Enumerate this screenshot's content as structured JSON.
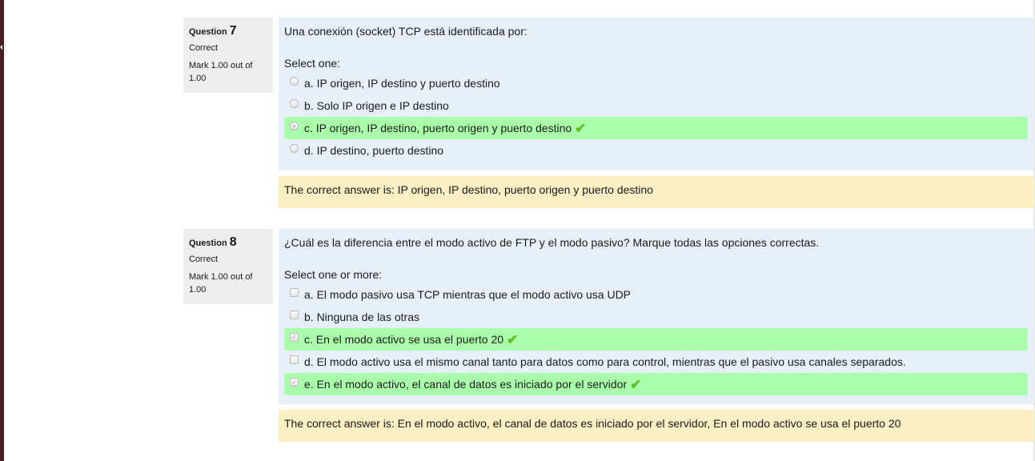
{
  "questions": [
    {
      "label": "Question",
      "number": "7",
      "state": "Correct",
      "grade": "Mark 1.00 out of 1.00",
      "text": "Una conexión (socket) TCP está identificada por:",
      "prompt": "Select one:",
      "input_type": "radio",
      "answers": [
        {
          "label": "a. IP origen, IP destino y puerto destino",
          "selected": false,
          "correct": false
        },
        {
          "label": "b. Solo IP origen e IP destino",
          "selected": false,
          "correct": false
        },
        {
          "label": "c. IP origen, IP destino, puerto origen y puerto destino",
          "selected": true,
          "correct": true
        },
        {
          "label": "d. IP destino, puerto destino",
          "selected": false,
          "correct": false
        }
      ],
      "feedback": "The correct answer is: IP origen, IP destino, puerto origen y puerto destino"
    },
    {
      "label": "Question",
      "number": "8",
      "state": "Correct",
      "grade": "Mark 1.00 out of 1.00",
      "text": "¿Cuál es la diferencia entre el modo activo de FTP y el modo pasivo? Marque todas las opciones correctas.",
      "prompt": "Select one or more:",
      "input_type": "checkbox",
      "answers": [
        {
          "label": "a. El modo pasivo usa TCP mientras que el modo activo usa UDP",
          "selected": false,
          "correct": false
        },
        {
          "label": "b. Ninguna de las otras",
          "selected": false,
          "correct": false
        },
        {
          "label": "c. En el modo activo se usa el puerto 20",
          "selected": true,
          "correct": true
        },
        {
          "label": "d. El modo activo usa el mismo canal tanto para datos como para control, mientras que el pasivo usa canales separados.",
          "selected": false,
          "correct": false
        },
        {
          "label": "e. En el modo activo, el canal de datos es iniciado por el servidor",
          "selected": true,
          "correct": true
        }
      ],
      "feedback": "The correct answer is: En el modo activo, el canal de datos es iniciado por el servidor, En el modo activo se usa el puerto 20"
    }
  ],
  "icons": {
    "correct_tick": "check-icon",
    "correct_color": "#66bb22"
  },
  "colors": {
    "correct_answer_bg": "#aaffaa",
    "formulation_bg": "#e7f0f8",
    "feedback_bg": "#fcefc3",
    "info_bg": "#eeeeee"
  }
}
